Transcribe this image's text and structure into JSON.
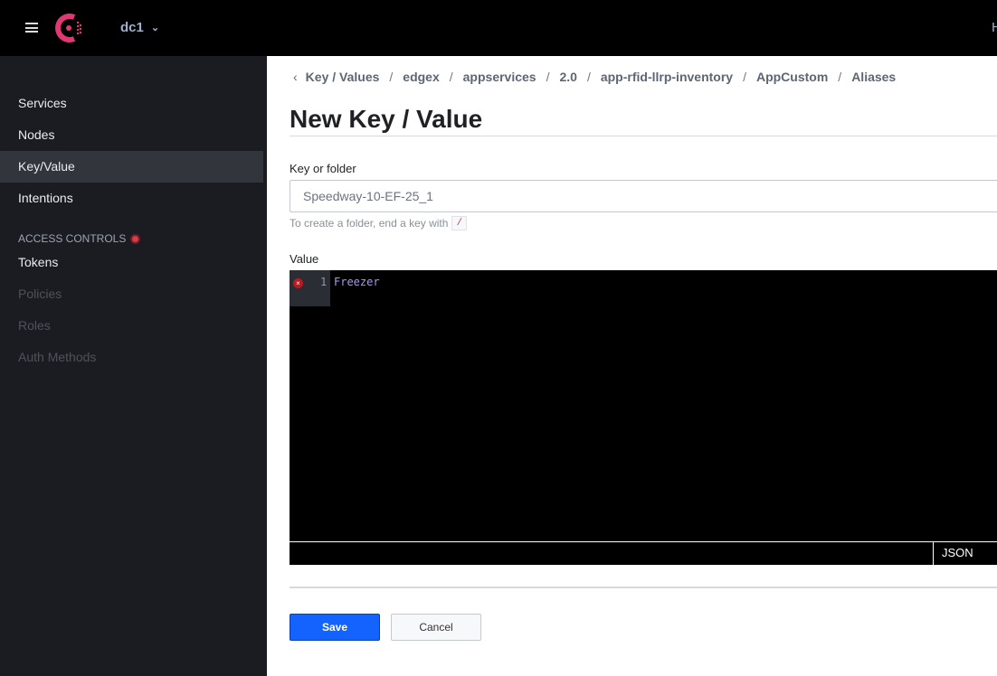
{
  "header": {
    "datacenter": "dc1",
    "right_text": "H",
    "brand_color": "#e03875"
  },
  "sidebar": {
    "items": [
      {
        "label": "Services"
      },
      {
        "label": "Nodes"
      },
      {
        "label": "Key/Value",
        "active": true
      },
      {
        "label": "Intentions"
      }
    ],
    "section": "ACCESS CONTROLS",
    "acl_items": [
      {
        "label": "Tokens"
      },
      {
        "label": "Policies",
        "disabled": true
      },
      {
        "label": "Roles",
        "disabled": true
      },
      {
        "label": "Auth Methods",
        "disabled": true
      }
    ]
  },
  "breadcrumbs": [
    "Key / Values",
    "edgex",
    "appservices",
    "2.0",
    "app-rfid-llrp-inventory",
    "AppCustom",
    "Aliases"
  ],
  "page": {
    "title": "New Key / Value"
  },
  "form": {
    "key_label": "Key or folder",
    "key_value": "Speedway-10-EF-25_1",
    "help_text": "To create a folder, end a key with",
    "help_code": "/",
    "value_label": "Value",
    "editor": {
      "line_number": "1",
      "content": "Freezer",
      "mode": "JSON",
      "has_error": true
    },
    "save": "Save",
    "cancel": "Cancel"
  }
}
